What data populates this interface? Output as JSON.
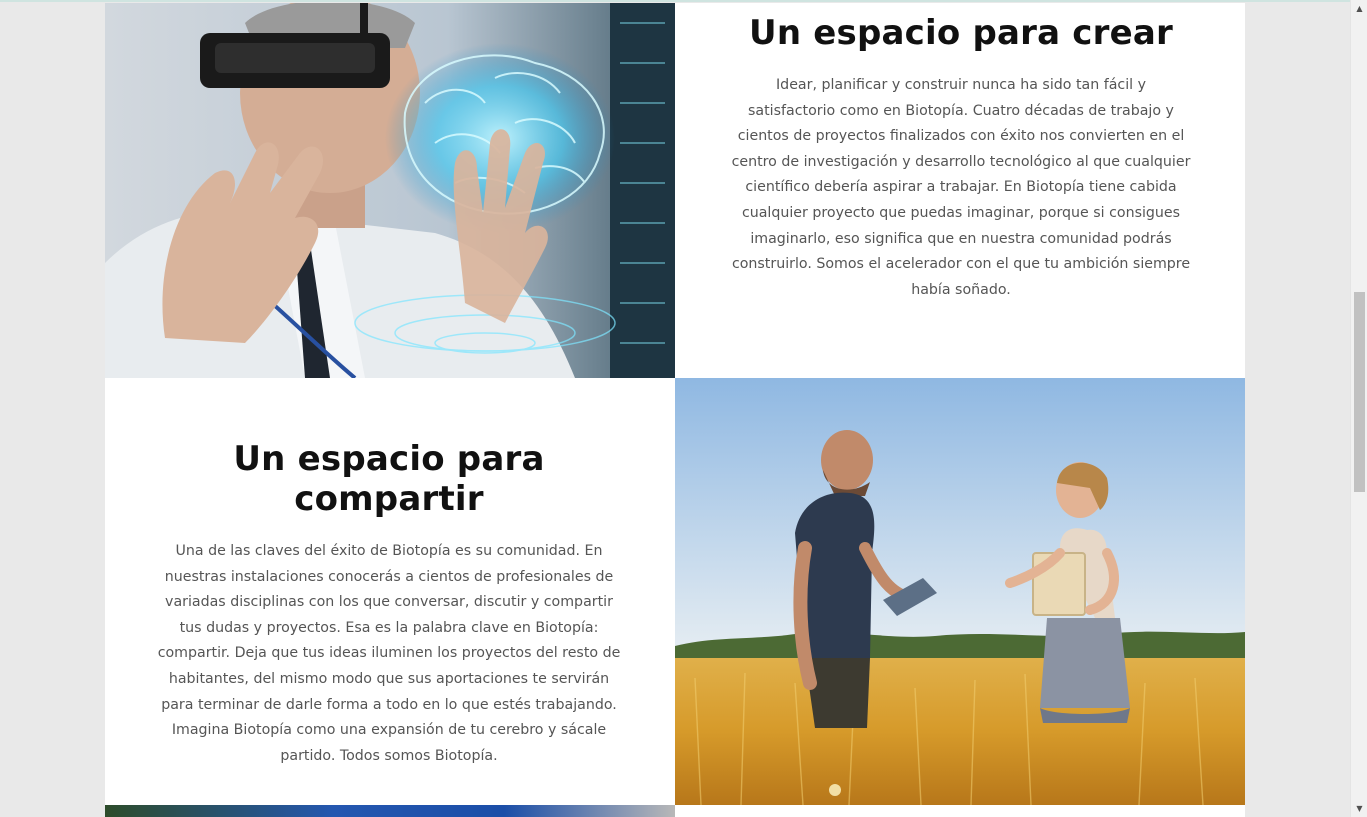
{
  "sections": {
    "create": {
      "title": "Un espacio para crear",
      "body": "Idear, planificar y construir nunca ha sido tan fácil y satisfactorio como en Biotopía. Cuatro décadas de trabajo y cientos de proyectos finalizados con éxito nos convierten en el centro de investigación y desarrollo tecnológico al que cualquier científico debería aspirar a trabajar. En Biotopía tiene cabida cualquier proyecto que puedas imaginar, porque si consigues imaginarlo, eso significa que en nuestra comunidad podrás construirlo. Somos el acelerador con el que tu ambición siempre había soñado."
    },
    "share": {
      "title": "Un espacio para compartir",
      "body": "Una de las claves del éxito de Biotopía es su comunidad. En nuestras instalaciones conocerás a cientos de profesionales de variadas disciplinas con los que conversar, discutir y compartir tus dudas y proyectos. Esa es la palabra clave en Biotopía: compartir. Deja que tus ideas iluminen los proyectos del resto de habitantes, del mismo modo que sus aportaciones te servirán para terminar de darle forma a todo en lo que estés trabajando. Imagina Biotopía como una expansión de tu cerebro y sácale partido. Todos somos Biotopía."
    }
  },
  "scrollbar": {
    "up_icon": "triangle-up",
    "down_icon": "triangle-down"
  }
}
